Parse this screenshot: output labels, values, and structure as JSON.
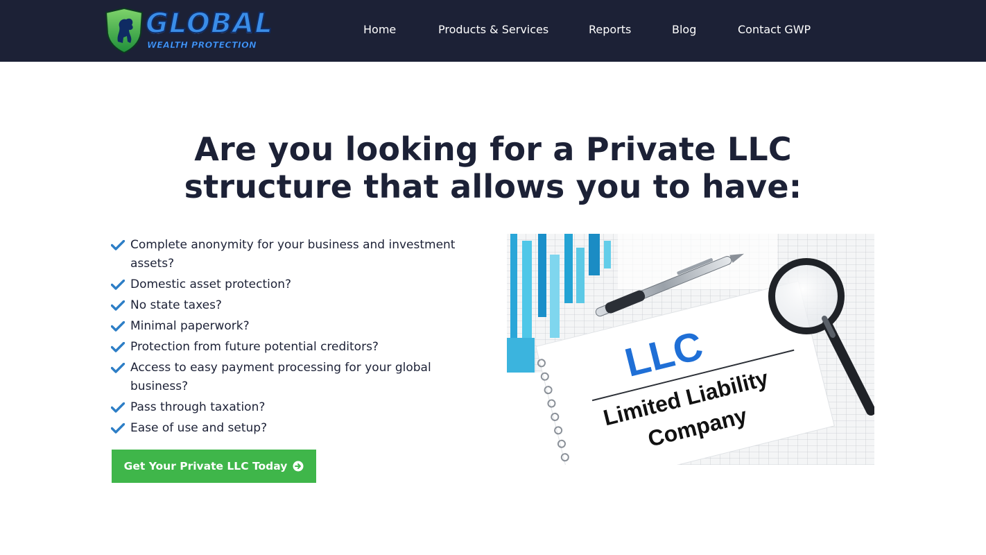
{
  "header": {
    "logo": {
      "word": "GLOBAL",
      "subword": "WEALTH PROTECTION"
    },
    "nav": [
      {
        "label": "Home"
      },
      {
        "label": "Products & Services"
      },
      {
        "label": "Reports"
      },
      {
        "label": "Blog"
      },
      {
        "label": "Contact GWP"
      }
    ]
  },
  "hero": {
    "title_line1": "Are you looking for a Private LLC",
    "title_line2": "structure that allows you to have:",
    "checklist": [
      "Complete anonymity for your business and investment assets?",
      "Domestic asset protection?",
      "No state taxes?",
      "Minimal paperwork?",
      "Protection from future potential creditors?",
      "Access to easy payment processing for your global business?",
      "Pass through taxation?",
      "Ease of use and setup?"
    ],
    "cta_label": "Get Your Private LLC Today",
    "image": {
      "heading": "LLC",
      "line1": "Limited Liability",
      "line2": "Company"
    }
  },
  "colors": {
    "header_bg": "#1c2136",
    "text_dark": "#1c2136",
    "check_blue": "#2d7ec6",
    "cta_green": "#3fb64a",
    "llc_blue": "#1f6fd6"
  }
}
